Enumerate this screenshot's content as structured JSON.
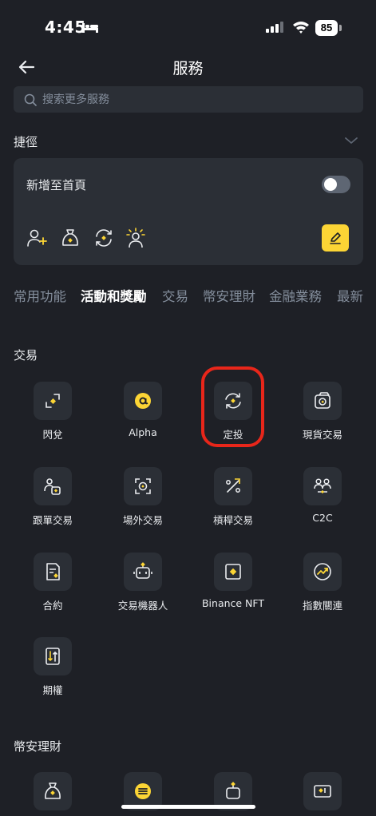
{
  "status_bar": {
    "time": "4:45",
    "battery": "85"
  },
  "header": {
    "title": "服務"
  },
  "search": {
    "placeholder": "搜索更多服務"
  },
  "shortcuts": {
    "title": "捷徑",
    "add_to_home": "新增至首頁",
    "toggle_on": false,
    "icons": [
      "add-user-icon",
      "bag-icon",
      "recurring-icon",
      "person-sun-icon"
    ]
  },
  "tabs": [
    "常用功能",
    "活動和獎勵",
    "交易",
    "幣安理財",
    "金融業務",
    "最新"
  ],
  "active_tab": "活動和獎勵",
  "sections": {
    "trade": {
      "title": "交易",
      "items": [
        {
          "label": "閃兌",
          "icon": "convert-icon"
        },
        {
          "label": "Alpha",
          "icon": "alpha-icon"
        },
        {
          "label": "定投",
          "icon": "recurring-buy-icon",
          "highlighted": true
        },
        {
          "label": "現貨交易",
          "icon": "spot-icon"
        },
        {
          "label": "跟單交易",
          "icon": "copy-trading-icon"
        },
        {
          "label": "場外交易",
          "icon": "otc-icon"
        },
        {
          "label": "槓桿交易",
          "icon": "margin-icon"
        },
        {
          "label": "C2C",
          "icon": "c2c-icon"
        },
        {
          "label": "合約",
          "icon": "futures-icon"
        },
        {
          "label": "交易機器人",
          "icon": "bot-icon"
        },
        {
          "label": "Binance NFT",
          "icon": "nft-icon"
        },
        {
          "label": "指數關連",
          "icon": "index-linked-icon"
        },
        {
          "label": "期權",
          "icon": "options-icon"
        }
      ]
    },
    "earn": {
      "title": "幣安理財",
      "items": [
        {
          "icon": "bag-icon"
        },
        {
          "icon": "stack-coin-icon"
        },
        {
          "icon": "auto-invest-icon"
        },
        {
          "icon": "ticket-icon"
        }
      ]
    }
  },
  "colors": {
    "background": "#1e2026",
    "surface": "#2b2f36",
    "accent": "#fcd535",
    "highlight_ring": "#e8261a"
  }
}
